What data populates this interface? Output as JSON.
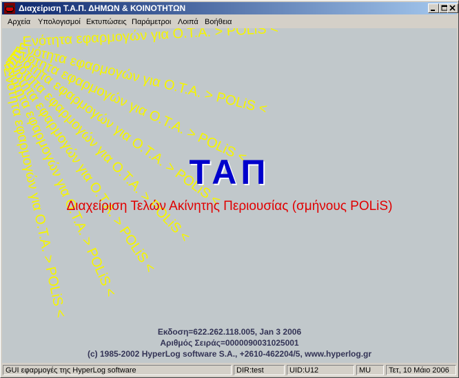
{
  "window": {
    "title": "Διαχείριση Τ.Α.Π. ΔΗΜΩΝ & ΚΟΙΝΟΤΗΤΩΝ"
  },
  "menu": [
    "Αρχεία",
    "Υπολογισμοί",
    "Εκτυπώσεις",
    "Παράμετροι",
    "Λοιπά",
    "Βοήθεια"
  ],
  "banner": {
    "fan_text": "Ενότητα εφαρμογών για Ο.Τ.Α. > POLiS <",
    "title": "ΤΑΠ",
    "subtitle": "Διαχείριση Τελών Ακίνητης Περιουσίας (σμήνους POLiS)"
  },
  "info": {
    "version": "Εκδοση=622.262.118.005, Jan  3 2006",
    "serial": "Αριθμός Σειράς=0000090031025001",
    "copyright": "(c) 1985-2002 HyperLog software S.A., +2610-462204/5, www.hyperlog.gr"
  },
  "status": {
    "description": "GUI εφαρμογές της HyperLog software",
    "dir": "DIR:test",
    "uid": "UID:U12",
    "mode": "MU",
    "date": "Τετ, 10 Μάιο 2006"
  },
  "colors": {
    "fan_text": "#f5f500",
    "title": "#0000cc",
    "subtitle": "#e00000",
    "background": "#c1c8cb"
  }
}
